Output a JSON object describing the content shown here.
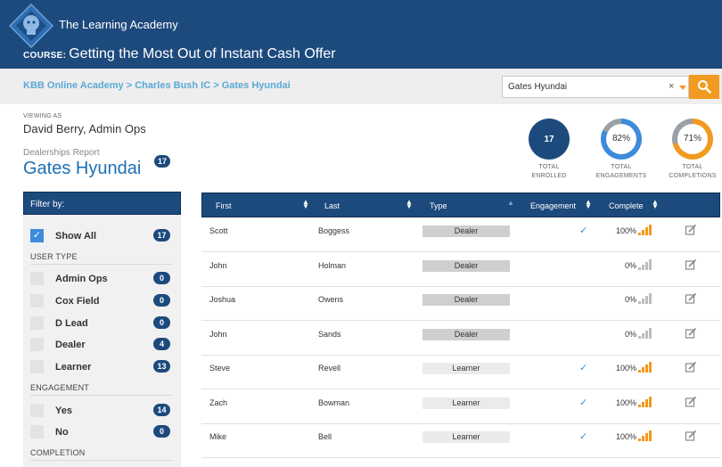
{
  "header": {
    "brand": "The Learning Academy",
    "course_prefix": "COURSE:",
    "course_title": "Getting the Most Out of Instant Cash Offer"
  },
  "breadcrumb": "KBB Online Academy > Charles Bush IC > Gates Hyundai",
  "search": {
    "value": "Gates Hyundai",
    "clear": "×"
  },
  "viewing": {
    "label": "VIEWING AS",
    "name": "David Berry, Admin Ops"
  },
  "report": {
    "label": "Dealerships Report",
    "dealer": "Gates Hyundai",
    "count": "17"
  },
  "stats": {
    "enrolled": {
      "value": "17",
      "label1": "TOTAL",
      "label2": "ENROLLED"
    },
    "engagements": {
      "value": "82%",
      "fraction": 0.82,
      "label1": "TOTAL",
      "label2": "ENGAGEMENTS"
    },
    "completions": {
      "value": "71%",
      "fraction": 0.71,
      "label1": "TOTAL",
      "label2": "COMPLETIONS"
    }
  },
  "filter": {
    "title": "Filter by:",
    "show_all": {
      "label": "Show All",
      "count": "17",
      "checked": true
    },
    "user_type_header": "USER TYPE",
    "user_types": [
      {
        "label": "Admin Ops",
        "count": "0"
      },
      {
        "label": "Cox Field",
        "count": "0"
      },
      {
        "label": "D Lead",
        "count": "0"
      },
      {
        "label": "Dealer",
        "count": "4"
      },
      {
        "label": "Learner",
        "count": "13"
      }
    ],
    "engagement_header": "ENGAGEMENT",
    "engagement": [
      {
        "label": "Yes",
        "count": "14"
      },
      {
        "label": "No",
        "count": "0"
      }
    ],
    "completion_header": "COMPLETION"
  },
  "table": {
    "columns": [
      "First",
      "Last",
      "Type",
      "Engagement",
      "Complete"
    ],
    "rows": [
      {
        "first": "Scott",
        "last": "Boggess",
        "type": "Dealer",
        "engaged": true,
        "complete": "100%"
      },
      {
        "first": "John",
        "last": "Holman",
        "type": "Dealer",
        "engaged": false,
        "complete": "0%"
      },
      {
        "first": "Joshua",
        "last": "Owens",
        "type": "Dealer",
        "engaged": false,
        "complete": "0%"
      },
      {
        "first": "John",
        "last": "Sands",
        "type": "Dealer",
        "engaged": false,
        "complete": "0%"
      },
      {
        "first": "Steve",
        "last": "Revell",
        "type": "Learner",
        "engaged": true,
        "complete": "100%"
      },
      {
        "first": "Zach",
        "last": "Bowman",
        "type": "Learner",
        "engaged": true,
        "complete": "100%"
      },
      {
        "first": "Mike",
        "last": "Bell",
        "type": "Learner",
        "engaged": true,
        "complete": "100%"
      }
    ]
  },
  "colors": {
    "navy": "#1d4a7d",
    "accent_blue": "#3d8bdc",
    "orange": "#f29a1f",
    "link": "#5aa9d6"
  }
}
